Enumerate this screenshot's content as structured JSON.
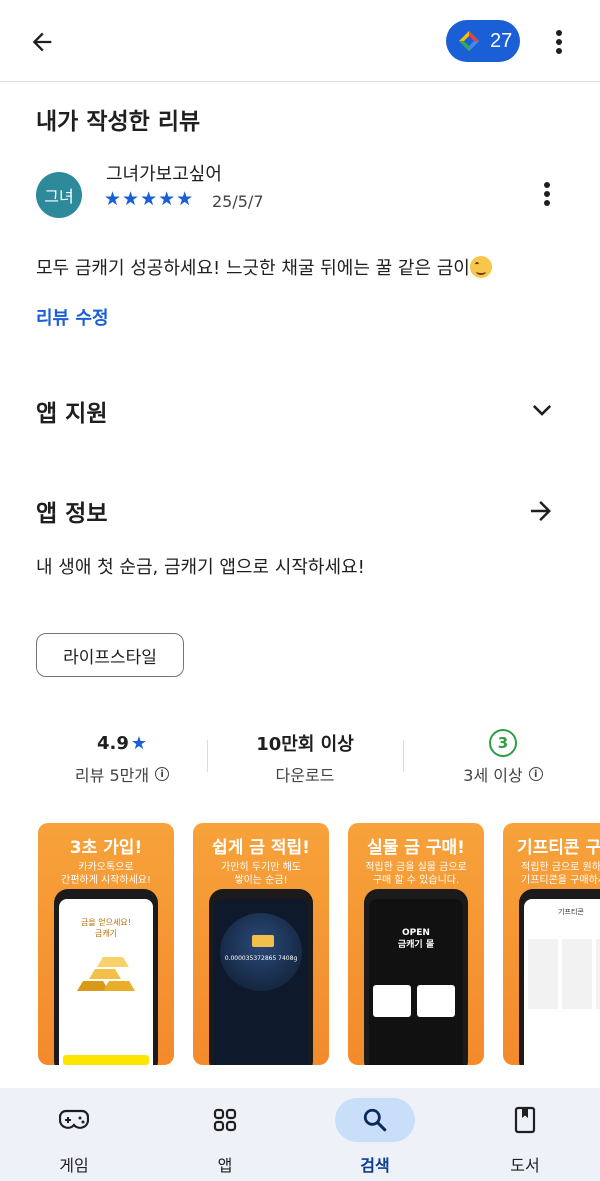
{
  "topbar": {
    "points": "27"
  },
  "review_section": {
    "title": "내가 작성한 리뷰",
    "avatar_text": "그녀",
    "reviewer": "그녀가보고싶어",
    "stars": "★★★★★",
    "date": "25/5/7",
    "text": "모두 금캐기 성공하세요! 느긋한 채굴 뒤에는 꿀 같은 금이",
    "edit_label": "리뷰 수정"
  },
  "app_support": {
    "label": "앱 지원"
  },
  "app_info": {
    "label": "앱 정보",
    "description": "내 생애 첫 순금, 금캐기 앱으로 시작하세요!",
    "category_chip": "라이프스타일"
  },
  "stats": {
    "rating": "4.9",
    "reviews": "리뷰 5만개",
    "downloads": "10만회 이상",
    "downloads_label": "다운로드",
    "age_badge": "3",
    "age_label": "3세 이상"
  },
  "screenshots": [
    {
      "heading": "3초 가입!",
      "sub": "카카오톡으로\n간편하게 시작하세요!",
      "screen_text": "금을 얻으세요!\n금캐기"
    },
    {
      "heading": "쉽게 금 적립!",
      "sub": "가만히 두기만 해도\n쌓이는 순금!",
      "screen_text": "0.000035372865 7408g"
    },
    {
      "heading": "실물 금 구매!",
      "sub": "적립한 금을 실물 금으로\n구매 할 수 있습니다.",
      "screen_text": "OPEN\n금캐기 몰"
    },
    {
      "heading": "기프티콘 구",
      "sub": "적립한 금으로 원하\n기프티콘을 구매하세",
      "screen_text": "기프티콘"
    }
  ],
  "bottom_nav": {
    "games": "게임",
    "apps": "앱",
    "search": "검색",
    "books": "도서"
  },
  "colors": {
    "accent": "#1a5fd6",
    "avatar": "#2e8a9a",
    "age_green": "#2f9e44",
    "shot_orange": "#f59636"
  }
}
